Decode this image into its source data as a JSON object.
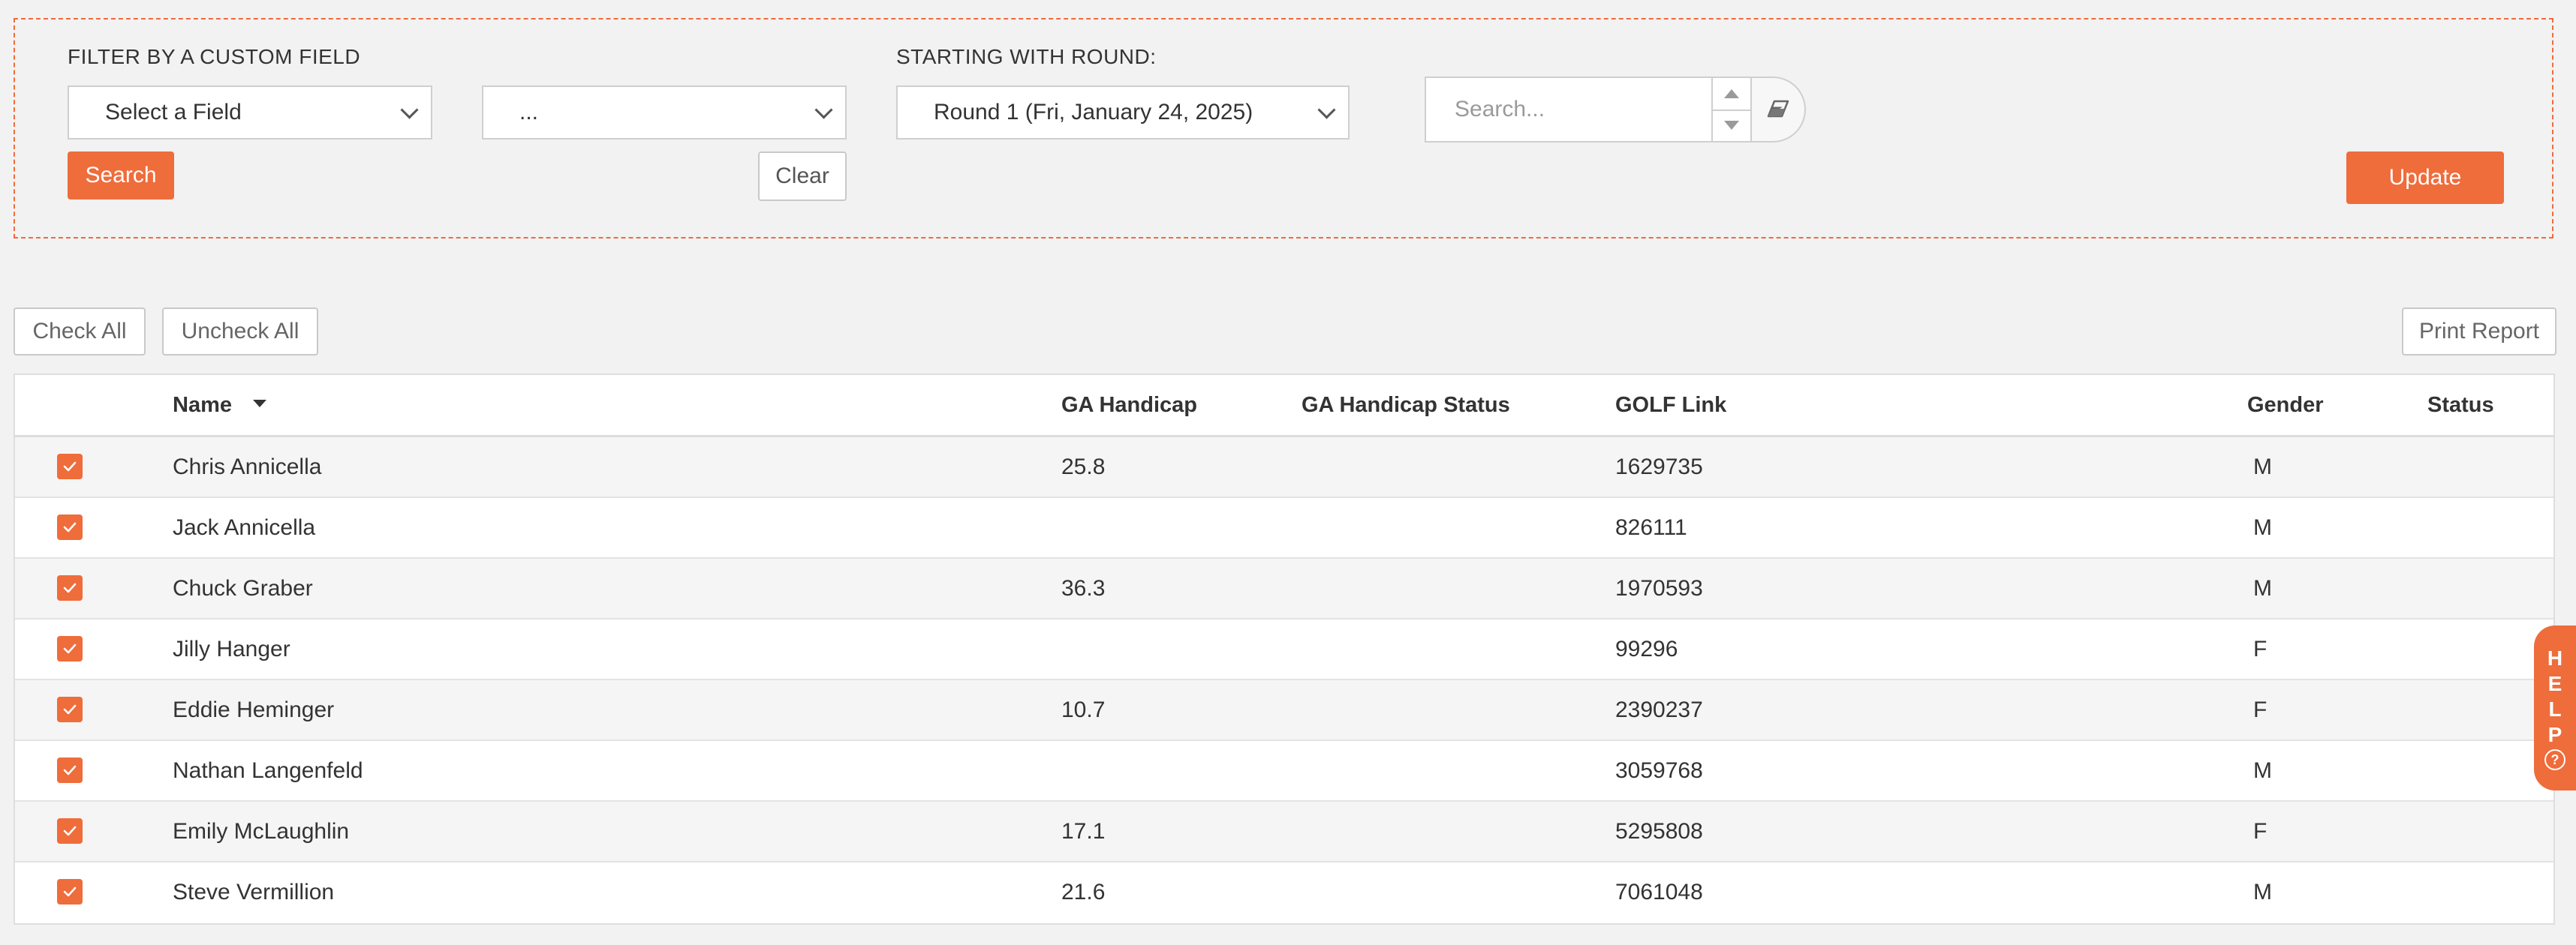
{
  "filter": {
    "custom_field_label": "FILTER BY A CUSTOM FIELD",
    "field_select_value": "Select a Field",
    "value_select_value": "...",
    "round_label": "STARTING WITH ROUND:",
    "round_select_value": "Round 1 (Fri, January 24, 2025)",
    "search_button": "Search",
    "clear_button": "Clear",
    "search_placeholder": "Search...",
    "update_button": "Update"
  },
  "toolbar": {
    "check_all": "Check All",
    "uncheck_all": "Uncheck All",
    "print_report": "Print Report"
  },
  "table": {
    "headers": {
      "name": "Name",
      "ga_handicap": "GA Handicap",
      "ga_handicap_status": "GA Handicap Status",
      "golf_link": "GOLF Link",
      "gender": "Gender",
      "status": "Status"
    },
    "rows": [
      {
        "checked": true,
        "name": "Chris Annicella",
        "ga_handicap": "25.8",
        "ga_handicap_status": "",
        "golf_link": "1629735",
        "gender": "M",
        "status": ""
      },
      {
        "checked": true,
        "name": "Jack Annicella",
        "ga_handicap": "",
        "ga_handicap_status": "",
        "golf_link": "826111",
        "gender": "M",
        "status": ""
      },
      {
        "checked": true,
        "name": "Chuck Graber",
        "ga_handicap": "36.3",
        "ga_handicap_status": "",
        "golf_link": "1970593",
        "gender": "M",
        "status": ""
      },
      {
        "checked": true,
        "name": "Jilly Hanger",
        "ga_handicap": "",
        "ga_handicap_status": "",
        "golf_link": "99296",
        "gender": "F",
        "status": ""
      },
      {
        "checked": true,
        "name": "Eddie Heminger",
        "ga_handicap": "10.7",
        "ga_handicap_status": "",
        "golf_link": "2390237",
        "gender": "F",
        "status": ""
      },
      {
        "checked": true,
        "name": "Nathan Langenfeld",
        "ga_handicap": "",
        "ga_handicap_status": "",
        "golf_link": "3059768",
        "gender": "M",
        "status": ""
      },
      {
        "checked": true,
        "name": "Emily McLaughlin",
        "ga_handicap": "17.1",
        "ga_handicap_status": "",
        "golf_link": "5295808",
        "gender": "F",
        "status": ""
      },
      {
        "checked": true,
        "name": "Steve Vermillion",
        "ga_handicap": "21.6",
        "ga_handicap_status": "",
        "golf_link": "7061048",
        "gender": "M",
        "status": ""
      }
    ]
  },
  "help_tab": {
    "letters": [
      "H",
      "E",
      "L",
      "P"
    ],
    "icon": "question-circle-icon"
  },
  "colors": {
    "accent": "#ef6c3b",
    "background": "#f2f2f2"
  }
}
